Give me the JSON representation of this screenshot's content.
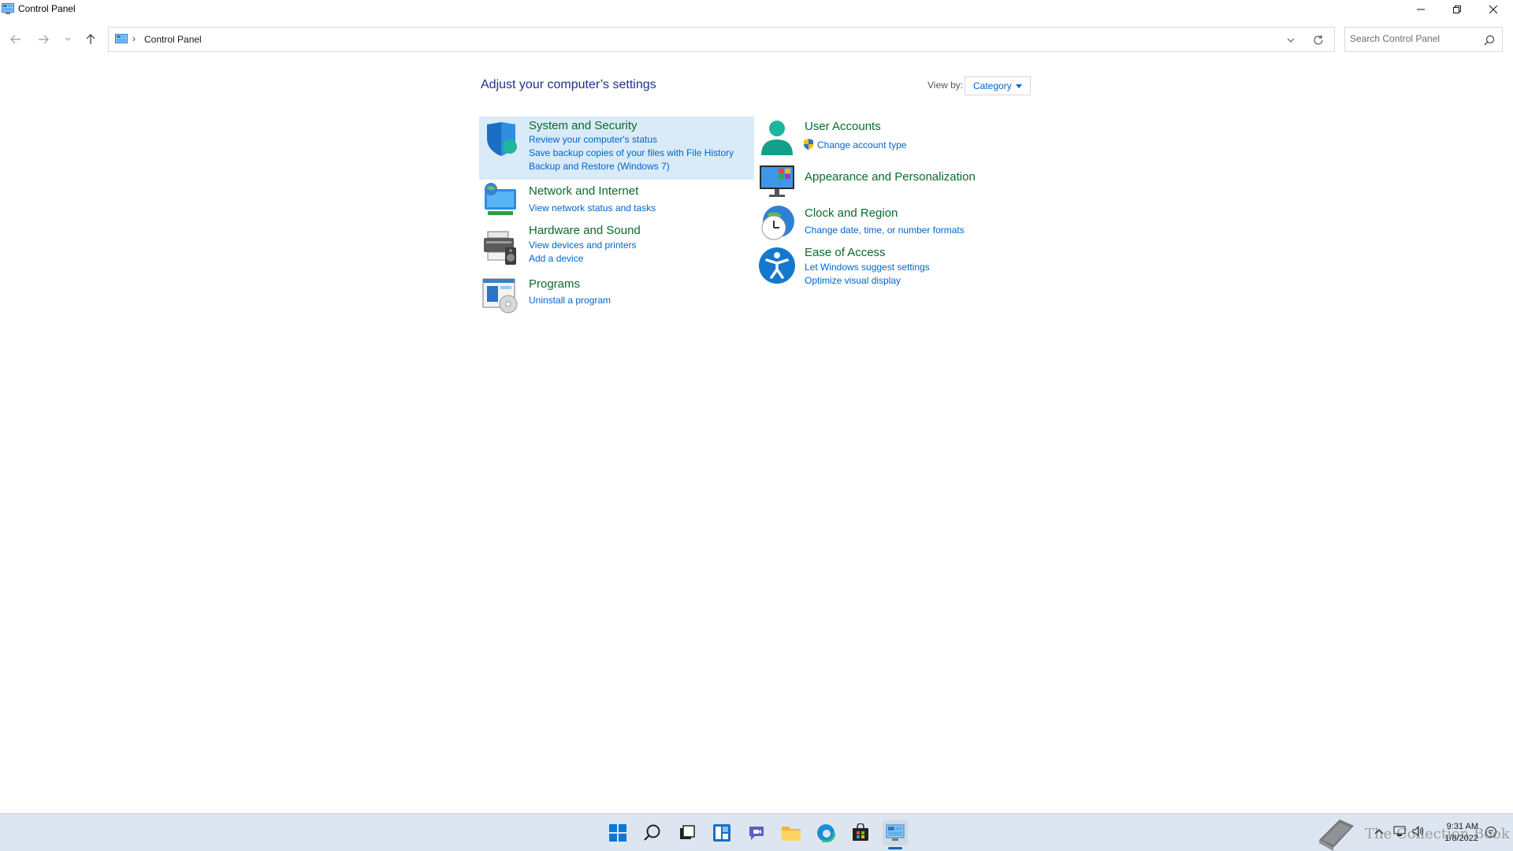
{
  "window": {
    "title": "Control Panel"
  },
  "address": {
    "breadcrumb": "Control Panel",
    "search_placeholder": "Search Control Panel"
  },
  "main": {
    "heading": "Adjust your computer’s settings",
    "view_by_label": "View by:",
    "view_by_value": "Category",
    "categories_left": [
      {
        "title": "System and Security",
        "icon": "shield-icon",
        "links": [
          "Review your computer's status",
          "Save backup copies of your files with File History",
          "Backup and Restore (Windows 7)"
        ]
      },
      {
        "title": "Network and Internet",
        "icon": "network-globe-icon",
        "links": [
          "View network status and tasks"
        ]
      },
      {
        "title": "Hardware and Sound",
        "icon": "printer-speaker-icon",
        "links": [
          "View devices and printers",
          "Add a device"
        ]
      },
      {
        "title": "Programs",
        "icon": "programs-disc-icon",
        "links": [
          "Uninstall a program"
        ]
      }
    ],
    "categories_right": [
      {
        "title": "User Accounts",
        "icon": "user-icon",
        "links": [
          "Change account type"
        ]
      },
      {
        "title": "Appearance and Personalization",
        "icon": "monitor-palette-icon",
        "links": []
      },
      {
        "title": "Clock and Region",
        "icon": "clock-globe-icon",
        "links": [
          "Change date, time, or number formats"
        ]
      },
      {
        "title": "Ease of Access",
        "icon": "accessibility-icon",
        "links": [
          "Let Windows suggest settings",
          "Optimize visual display"
        ]
      }
    ]
  },
  "taskbar": {
    "apps": [
      "start-icon",
      "search-icon",
      "task-view-icon",
      "widgets-icon",
      "chat-icon",
      "file-explorer-icon",
      "edge-icon",
      "store-icon",
      "control-panel-icon"
    ],
    "watermark": "The Collection Book",
    "time": "9:31 AM",
    "date": "1/8/2022"
  },
  "colors": {
    "category_title": "#0b6a2e",
    "link": "#0066cc",
    "heading": "#1e3287",
    "hover_bg": "#d9eaf9",
    "taskbar_bg": "#dde6f0"
  }
}
